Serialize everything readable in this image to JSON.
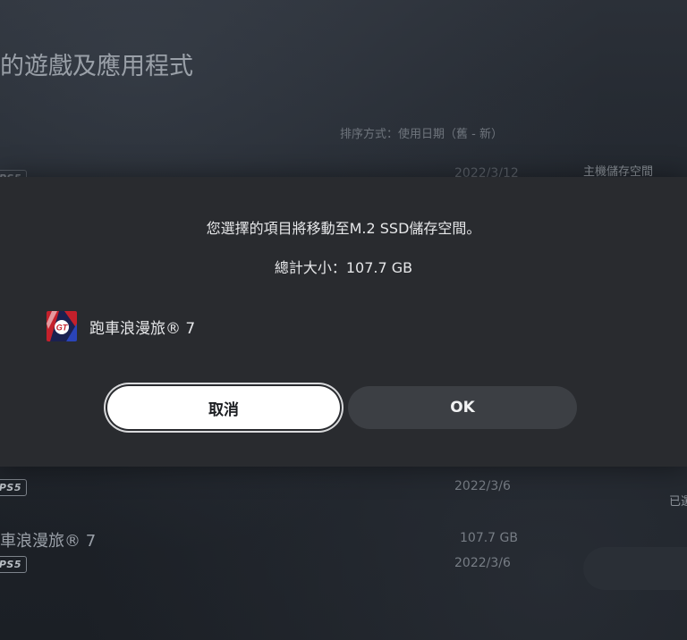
{
  "background": {
    "page_title": "的遊戲及應用程式",
    "sort_label": "排序方式：使用日期（舊 - 新）",
    "storage_label": "主機儲存空間",
    "faded_date": "2022/3/12",
    "selected_label": "已選",
    "ps5_badge": "PS5",
    "rows": [
      {
        "date": "2022/3/6"
      },
      {
        "name": "車浪漫旅® 7",
        "size": "107.7 GB",
        "date": "2022/3/6"
      }
    ]
  },
  "dialog": {
    "message": "您選擇的項目將移動至M.2 SSD儲存空間。",
    "total_size": "總計大小：107.7 GB",
    "item": {
      "name": "跑車浪漫旅® 7",
      "icon": "gran-turismo-7-icon"
    },
    "cancel_label": "取消",
    "ok_label": "OK"
  },
  "colors": {
    "dialog_bg": "#292b2f",
    "cancel_bg": "#ffffff",
    "ok_bg": "#3c3f44",
    "page_bg": "#1f242b"
  }
}
